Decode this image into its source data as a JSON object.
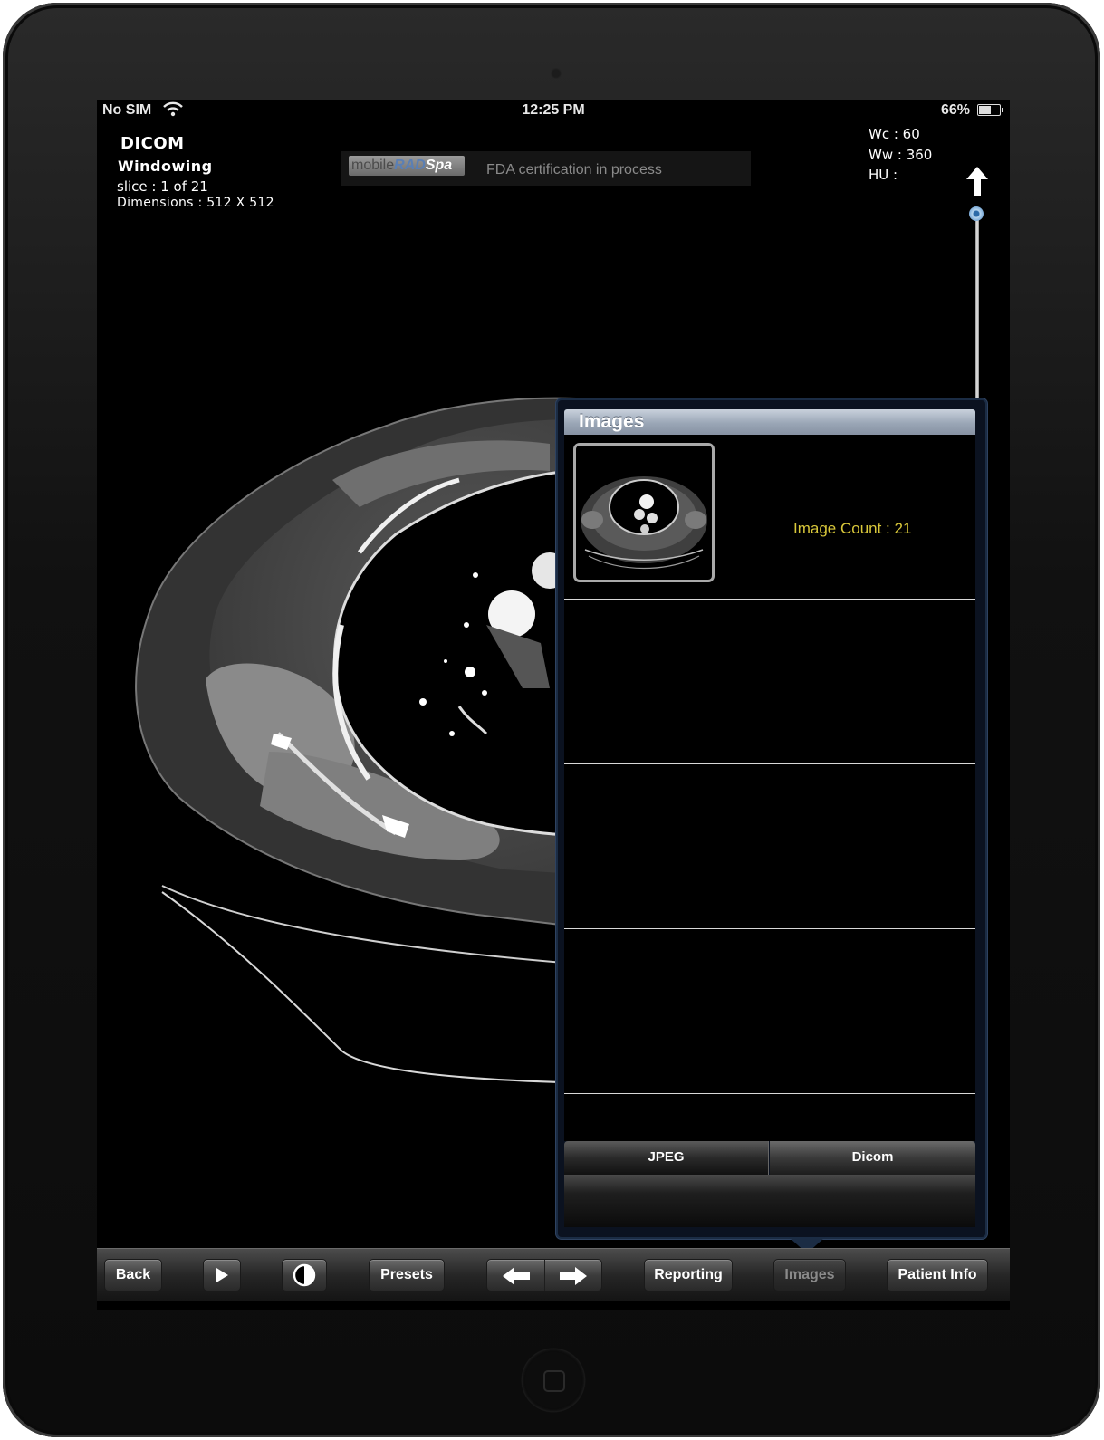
{
  "status_bar": {
    "carrier": "No SIM",
    "time": "12:25 PM",
    "battery": "66%",
    "battery_level": 0.66
  },
  "overlay": {
    "title": "DICOM",
    "mode": "Windowing",
    "slice": "slice : 1 of 21",
    "dimensions": "Dimensions : 512 X 512",
    "wc": "Wc : 60",
    "ww": "Ww : 360",
    "hu": "HU :"
  },
  "banner": {
    "logo_part1": "mobile",
    "logo_part2": "RAD",
    "logo_part3": "Spa",
    "text": "FDA certification in process"
  },
  "images_popover": {
    "title": "Images",
    "image_count": "Image Count : 21",
    "format_options": [
      "JPEG",
      "Dicom"
    ]
  },
  "toolbar": {
    "back": "Back",
    "presets": "Presets",
    "reporting": "Reporting",
    "images": "Images",
    "patient_info": "Patient Info"
  },
  "colors": {
    "background": "#000000",
    "count_text": "#d8c73a",
    "popover_header": "#9aa6b6"
  },
  "icons": [
    "wifi-icon",
    "battery-icon",
    "up-arrow-icon",
    "play-icon",
    "contrast-icon",
    "left-arrow-icon",
    "right-arrow-icon",
    "home-button-icon"
  ]
}
